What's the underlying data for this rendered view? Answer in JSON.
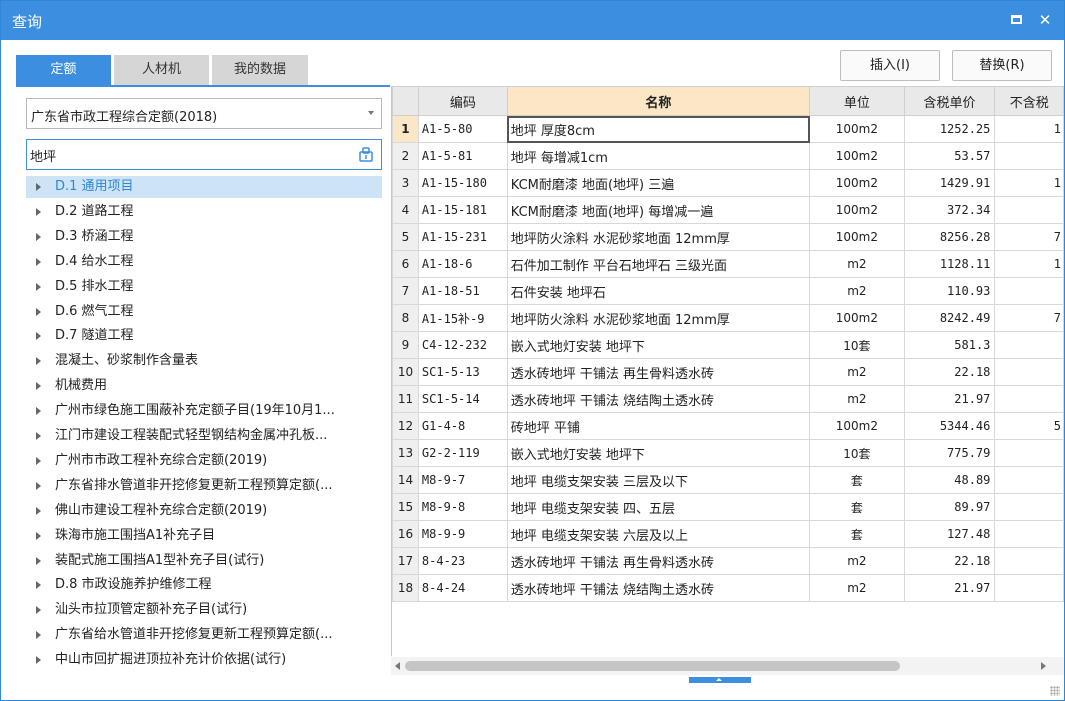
{
  "window": {
    "title": "查询"
  },
  "tabs": [
    {
      "label": "定额",
      "active": true
    },
    {
      "label": "人材机",
      "active": false
    },
    {
      "label": "我的数据",
      "active": false
    }
  ],
  "buttons": {
    "insert": "插入(I)",
    "replace": "替换(R)"
  },
  "quota_select": {
    "value": "广东省市政工程综合定额(2018)"
  },
  "search": {
    "value": "地坪"
  },
  "tree": [
    {
      "label": "D.1 通用项目",
      "selected": true
    },
    {
      "label": "D.2 道路工程"
    },
    {
      "label": "D.3 桥涵工程"
    },
    {
      "label": "D.4 给水工程"
    },
    {
      "label": "D.5 排水工程"
    },
    {
      "label": "D.6 燃气工程"
    },
    {
      "label": "D.7 隧道工程"
    },
    {
      "label": "混凝土、砂浆制作含量表"
    },
    {
      "label": "机械费用"
    },
    {
      "label": "广州市绿色施工围蔽补充定额子目(19年10月1..."
    },
    {
      "label": "江门市建设工程装配式轻型钢结构金属冲孔板..."
    },
    {
      "label": "广州市市政工程补充综合定额(2019)"
    },
    {
      "label": "广东省排水管道非开挖修复更新工程预算定额(..."
    },
    {
      "label": "佛山市建设工程补充综合定额(2019)"
    },
    {
      "label": "珠海市施工围挡A1补充子目"
    },
    {
      "label": "装配式施工围挡A1型补充子目(试行)"
    },
    {
      "label": "D.8 市政设施养护维修工程"
    },
    {
      "label": "汕头市拉顶管定额补充子目(试行)"
    },
    {
      "label": "广东省给水管道非开挖修复更新工程预算定额(..."
    },
    {
      "label": "中山市回扩掘进顶拉补充计价依据(试行)"
    }
  ],
  "grid": {
    "headers": {
      "code": "编码",
      "name": "名称",
      "unit": "单位",
      "price": "含税单价",
      "extra": "不含税"
    },
    "rows": [
      {
        "no": "1",
        "code": "A1-5-80",
        "name": "地坪 厚度8cm",
        "unit": "100m2",
        "price": "1252.25",
        "extra": "1"
      },
      {
        "no": "2",
        "code": "A1-5-81",
        "name": "地坪 每增减1cm",
        "unit": "100m2",
        "price": "53.57",
        "extra": ""
      },
      {
        "no": "3",
        "code": "A1-15-180",
        "name": "KCM耐磨漆 地面(地坪) 三遍",
        "unit": "100m2",
        "price": "1429.91",
        "extra": "1"
      },
      {
        "no": "4",
        "code": "A1-15-181",
        "name": "KCM耐磨漆 地面(地坪) 每增减一遍",
        "unit": "100m2",
        "price": "372.34",
        "extra": ""
      },
      {
        "no": "5",
        "code": "A1-15-231",
        "name": "地坪防火涂料 水泥砂浆地面 12mm厚",
        "unit": "100m2",
        "price": "8256.28",
        "extra": "7"
      },
      {
        "no": "6",
        "code": "A1-18-6",
        "name": "石件加工制作 平台石地坪石 三级光面",
        "unit": "m2",
        "price": "1128.11",
        "extra": "1"
      },
      {
        "no": "7",
        "code": "A1-18-51",
        "name": "石件安装 地坪石",
        "unit": "m2",
        "price": "110.93",
        "extra": ""
      },
      {
        "no": "8",
        "code": "A1-15补-9",
        "name": "地坪防火涂料 水泥砂浆地面 12mm厚",
        "unit": "100m2",
        "price": "8242.49",
        "extra": "7"
      },
      {
        "no": "9",
        "code": "C4-12-232",
        "name": "嵌入式地灯安装 地坪下",
        "unit": "10套",
        "price": "581.3",
        "extra": ""
      },
      {
        "no": "10",
        "code": "SC1-5-13",
        "name": "透水砖地坪 干铺法 再生骨料透水砖",
        "unit": "m2",
        "price": "22.18",
        "extra": ""
      },
      {
        "no": "11",
        "code": "SC1-5-14",
        "name": "透水砖地坪 干铺法 烧结陶土透水砖",
        "unit": "m2",
        "price": "21.97",
        "extra": ""
      },
      {
        "no": "12",
        "code": "G1-4-8",
        "name": "砖地坪 平铺",
        "unit": "100m2",
        "price": "5344.46",
        "extra": "5"
      },
      {
        "no": "13",
        "code": "G2-2-119",
        "name": "嵌入式地灯安装 地坪下",
        "unit": "10套",
        "price": "775.79",
        "extra": ""
      },
      {
        "no": "14",
        "code": "M8-9-7",
        "name": "地坪 电缆支架安装 三层及以下",
        "unit": "套",
        "price": "48.89",
        "extra": ""
      },
      {
        "no": "15",
        "code": "M8-9-8",
        "name": "地坪 电缆支架安装 四、五层",
        "unit": "套",
        "price": "89.97",
        "extra": ""
      },
      {
        "no": "16",
        "code": "M8-9-9",
        "name": "地坪 电缆支架安装 六层及以上",
        "unit": "套",
        "price": "127.48",
        "extra": ""
      },
      {
        "no": "17",
        "code": "8-4-23",
        "name": "透水砖地坪 干铺法 再生骨料透水砖",
        "unit": "m2",
        "price": "22.18",
        "extra": ""
      },
      {
        "no": "18",
        "code": "8-4-24",
        "name": "透水砖地坪 干铺法 烧结陶土透水砖",
        "unit": "m2",
        "price": "21.97",
        "extra": ""
      }
    ]
  },
  "colors": {
    "accent": "#3c8fe0",
    "header_highlight": "#fbe7c6",
    "selected_tree": "#cde4f7"
  },
  "icons": {
    "maximize": "maximize-icon",
    "close": "close-icon",
    "search": "search-icon",
    "expand": "expand-arrow-icon"
  }
}
